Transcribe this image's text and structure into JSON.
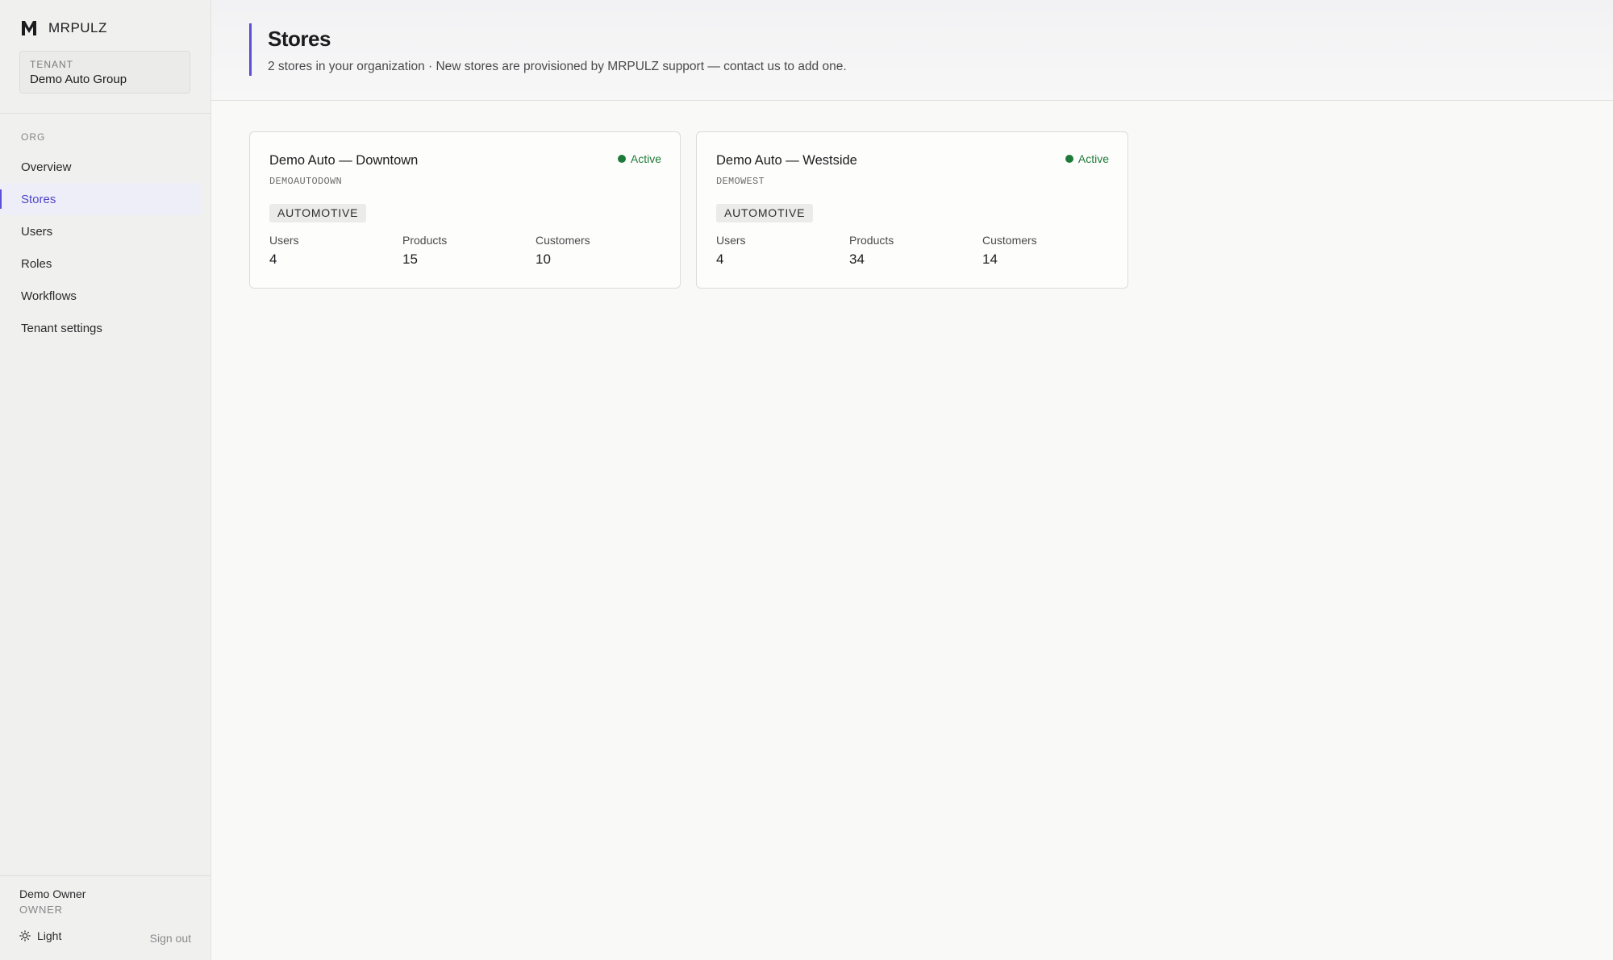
{
  "brand": {
    "name": "MRPULZ",
    "logo_icon": "m-logo-icon"
  },
  "tenant": {
    "label": "TENANT",
    "name": "Demo Auto Group"
  },
  "sidebar": {
    "section_label": "ORG",
    "items": [
      {
        "label": "Overview",
        "active": false
      },
      {
        "label": "Stores",
        "active": true
      },
      {
        "label": "Users",
        "active": false
      },
      {
        "label": "Roles",
        "active": false
      },
      {
        "label": "Workflows",
        "active": false
      },
      {
        "label": "Tenant settings",
        "active": false
      }
    ]
  },
  "user": {
    "name": "Demo Owner",
    "role": "OWNER"
  },
  "theme_toggle": {
    "label": "Light",
    "icon": "sun-icon"
  },
  "signout_label": "Sign out",
  "header": {
    "title": "Stores",
    "subtitle": "2 stores in your organization · New stores are provisioned by MRPULZ support — contact us to add one."
  },
  "stores": [
    {
      "name": "Demo Auto — Downtown",
      "code": "DEMOAUTODOWN",
      "status": "Active",
      "tag": "AUTOMOTIVE",
      "stats": [
        {
          "label": "Users",
          "value": "4"
        },
        {
          "label": "Products",
          "value": "15"
        },
        {
          "label": "Customers",
          "value": "10"
        }
      ]
    },
    {
      "name": "Demo Auto — Westside",
      "code": "DEMOWEST",
      "status": "Active",
      "tag": "AUTOMOTIVE",
      "stats": [
        {
          "label": "Users",
          "value": "4"
        },
        {
          "label": "Products",
          "value": "34"
        },
        {
          "label": "Customers",
          "value": "14"
        }
      ]
    }
  ],
  "colors": {
    "accent": "#5b4fd6",
    "active_status": "#1f7a3a",
    "sidebar_bg": "#f0f0ef",
    "page_bg": "#f9f9f7"
  }
}
